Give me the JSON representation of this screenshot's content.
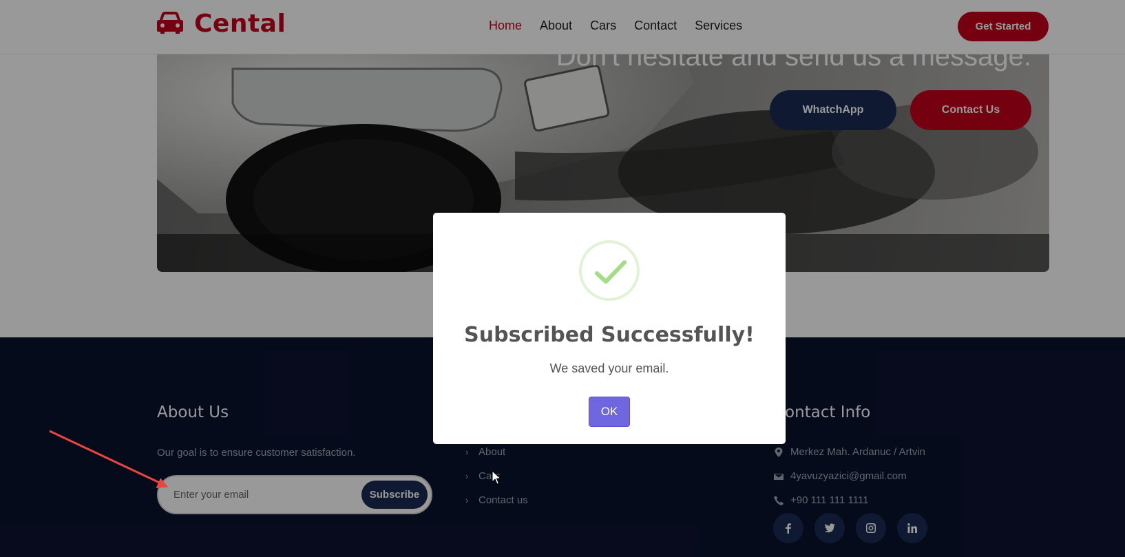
{
  "header": {
    "logo_text": "Cental",
    "logo_icon": "car-icon",
    "nav": [
      {
        "label": "Home",
        "active": true
      },
      {
        "label": "About",
        "active": false
      },
      {
        "label": "Cars",
        "active": false
      },
      {
        "label": "Contact",
        "active": false
      },
      {
        "label": "Services",
        "active": false
      }
    ],
    "cta_label": "Get Started"
  },
  "banner": {
    "headline": "Don't hesitate and send us a message.",
    "whatsapp_label": "WhatchApp",
    "contact_label": "Contact Us"
  },
  "footer": {
    "about": {
      "title": "About Us",
      "text": "Our goal is to ensure customer satisfaction.",
      "email_placeholder": "Enter your email",
      "subscribe_label": "Subscribe"
    },
    "links": [
      {
        "label": "About"
      },
      {
        "label": "Cars"
      },
      {
        "label": "Contact us"
      }
    ],
    "contact": {
      "title": "Contact Info",
      "address": "Merkez Mah. Ardanuc / Artvin",
      "email": "4yavuzyazici@gmail.com",
      "phone": "+90 111 111 1111",
      "social": [
        "facebook-icon",
        "twitter-icon",
        "instagram-icon",
        "linkedin-icon"
      ]
    }
  },
  "modal": {
    "title": "Subscribed Successfully!",
    "text": "We saved your email.",
    "ok_label": "OK",
    "icon": "checkmark-icon"
  },
  "colors": {
    "brand_red": "#c4001a",
    "navy": "#1a2a52",
    "footer_bg": "#0b1330",
    "ok_button": "#7066e0",
    "success_green": "#a5dc86"
  }
}
